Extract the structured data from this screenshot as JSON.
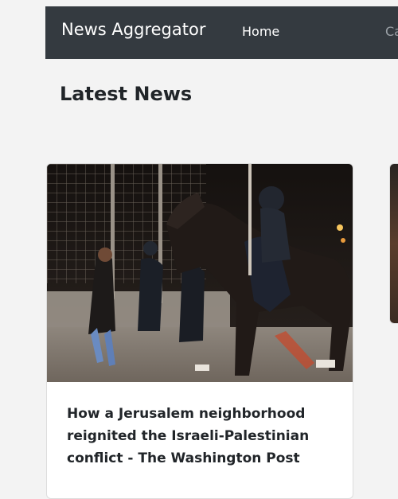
{
  "navbar": {
    "brand": "News Aggregator",
    "links": [
      {
        "label": "Home"
      },
      {
        "label": "Ca"
      }
    ]
  },
  "main": {
    "heading": "Latest News",
    "articles": [
      {
        "title": "How a Jerusalem neighborhood reignited the Israeli-Palestinian conflict - The Washington Post",
        "image_alt": "Mounted riot police and officers confronting protesters at night beside a fence"
      }
    ]
  }
}
